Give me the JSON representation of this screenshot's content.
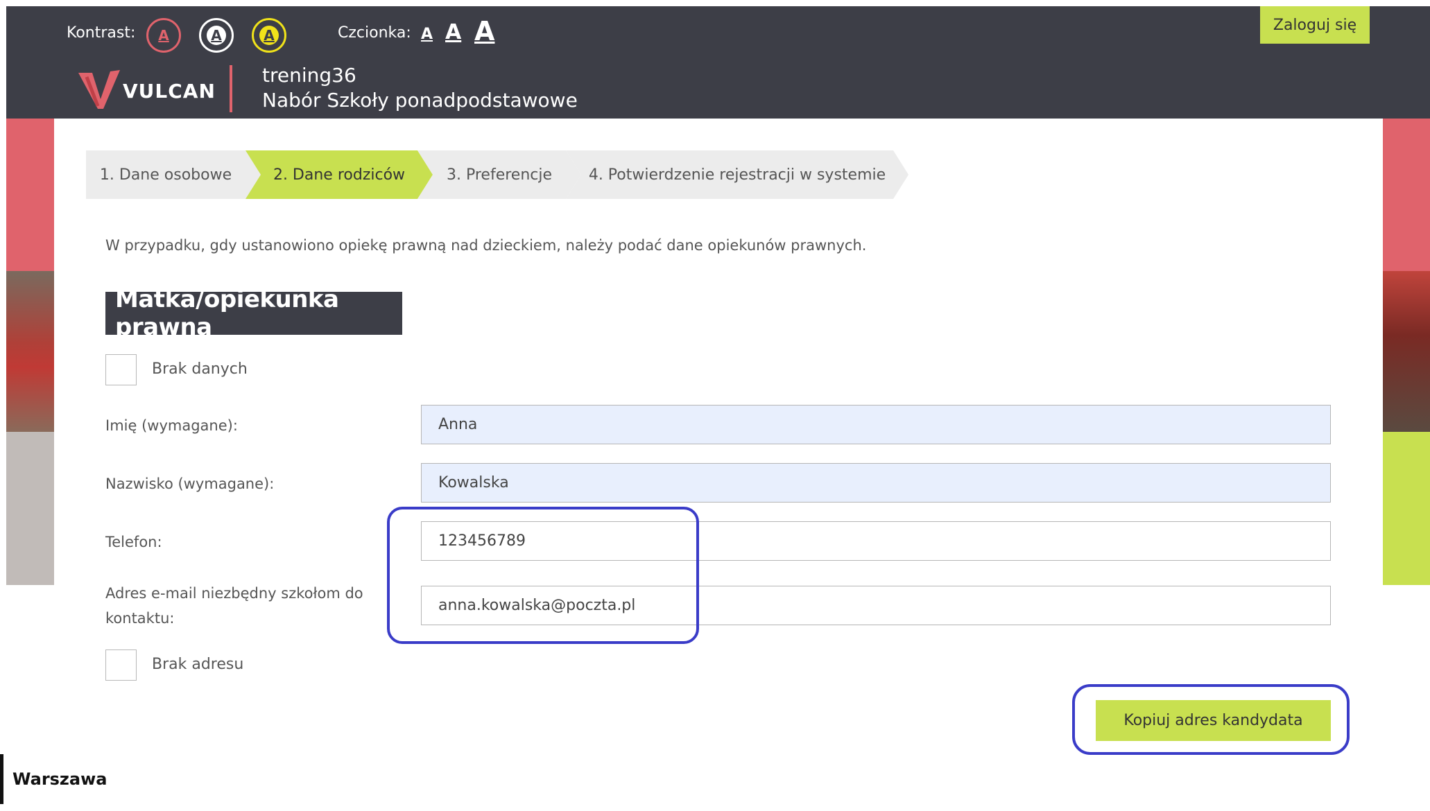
{
  "header": {
    "contrast_label": "Kontrast:",
    "contrast_options": [
      "A",
      "A",
      "A"
    ],
    "font_label": "Czcionka:",
    "font_options": [
      "A",
      "A",
      "A"
    ],
    "login_label": "Zaloguj się",
    "logo_text": "VULCAN",
    "title_line1": "trening36",
    "title_line2": "Nabór Szkoły ponadpodstawowe"
  },
  "steps": [
    {
      "label": "1. Dane osobowe",
      "active": false
    },
    {
      "label": "2. Dane rodziców",
      "active": true
    },
    {
      "label": "3. Preferencje",
      "active": false
    },
    {
      "label": "4. Potwierdzenie rejestracji w systemie",
      "active": false
    }
  ],
  "info_text": "W przypadku, gdy ustanowiono opiekę prawną nad dzieckiem, należy podać dane opiekunów prawnych.",
  "section": {
    "title": "Matka/opiekunka prawna",
    "no_data_label": "Brak danych",
    "fields": {
      "first_name": {
        "label": "Imię (wymagane):",
        "value": "Anna"
      },
      "last_name": {
        "label": "Nazwisko (wymagane):",
        "value": "Kowalska"
      },
      "phone": {
        "label": "Telefon:",
        "value": "123456789"
      },
      "email": {
        "label_line1": "Adres e-mail niezbędny szkołom do",
        "label_line2": "kontaktu:",
        "value": "anna.kowalska@poczta.pl"
      }
    },
    "no_address_label": "Brak adresu",
    "copy_button_label": "Kopiuj adres kandydata"
  },
  "footer": {
    "city_logo": "Warszawa"
  },
  "colors": {
    "header_bg": "#3d3e47",
    "accent_green": "#c8e050",
    "accent_pink": "#e0636c",
    "highlight_blue": "#3a3cc8"
  }
}
